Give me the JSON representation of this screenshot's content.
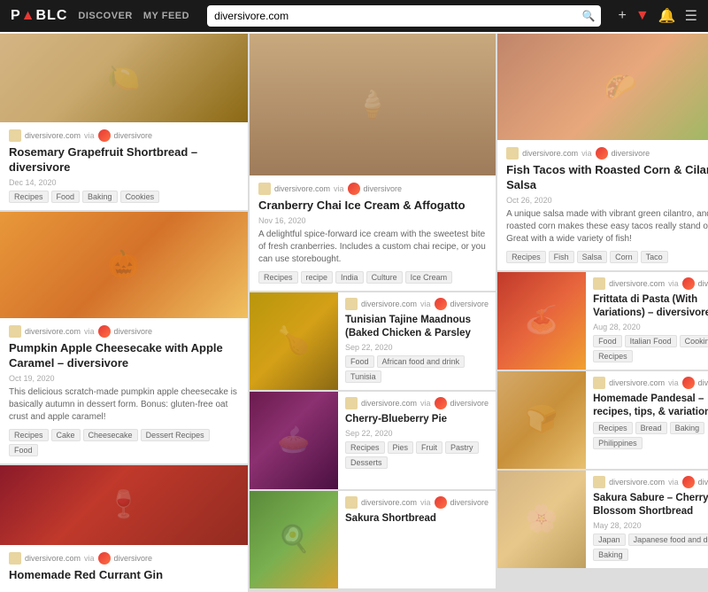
{
  "header": {
    "logo": "P▲BLC",
    "nav": [
      "DISCOVER",
      "MY FEED"
    ],
    "search_placeholder": "diversivore.com",
    "icons": {
      "+": "+",
      "heart": "♥",
      "bell": "🔔",
      "menu": "☰"
    }
  },
  "cards": {
    "rosemary": {
      "site": "diversivore.com",
      "via": "via",
      "user": "diversivore",
      "title": "Rosemary Grapefruit Shortbread – diversivore",
      "date": "Dec 14, 2020",
      "tags": [
        "Recipes",
        "Food",
        "Baking",
        "Cookies"
      ]
    },
    "pumpkin": {
      "site": "diversivore.com",
      "via": "via",
      "user": "diversivore",
      "title": "Pumpkin Apple Cheesecake with Apple Caramel – diversivore",
      "date": "Oct 19, 2020",
      "desc": "This delicious scratch-made pumpkin apple cheesecake is basically autumn in dessert form. Bonus: gluten-free oat crust and apple caramel!",
      "tags": [
        "Recipes",
        "Cake",
        "Cheesecake",
        "Dessert Recipes",
        "Food"
      ]
    },
    "redcurrant": {
      "site": "diversivore.com",
      "via": "via",
      "user": "diversivore",
      "title": "Homemade Red Currant Gin",
      "date": "",
      "tags": []
    },
    "cranberry": {
      "site": "diversivore.com",
      "via": "via",
      "user": "diversivore",
      "title": "Cranberry Chai Ice Cream & Affogatto",
      "date": "Nov 16, 2020",
      "desc": "A delightful spice-forward ice cream with the sweetest bite of fresh cranberries. Includes a custom chai recipe, or you can use storebought.",
      "tags": [
        "Recipes",
        "recipe",
        "India",
        "Culture",
        "Ice Cream"
      ]
    },
    "fishtacos": {
      "site": "diversivore.com",
      "via": "via",
      "user": "diversivore",
      "title": "Fish Tacos with Roasted Corn & Cilantro Salsa",
      "date": "Oct 26, 2020",
      "desc": "A unique salsa made with vibrant green cilantro, and roasted corn makes these easy tacos really stand out. Great with a wide variety of fish!",
      "tags": [
        "Recipes",
        "Fish",
        "Salsa",
        "Corn",
        "Taco"
      ]
    },
    "tunisian": {
      "site": "diversivore.com",
      "via": "via",
      "user": "diversivore",
      "title": "Tunisian Tajine Maadnous (Baked Chicken & Parsley",
      "date": "Sep 22, 2020",
      "tags": [
        "Food",
        "African food and drink",
        "Tunisia"
      ]
    },
    "frittata": {
      "site": "diversivore.com",
      "via": "via",
      "user": "diversivore",
      "title": "Frittata di Pasta (With Variations) – diversivore",
      "date": "Aug 28, 2020",
      "tags": [
        "Food",
        "Italian Food",
        "Cooking",
        "Recipes"
      ]
    },
    "cherry": {
      "site": "diversivore.com",
      "via": "via",
      "user": "diversivore",
      "title": "Cherry-Blueberry Pie",
      "date": "Sep 22, 2020",
      "tags": [
        "Recipes",
        "Pies",
        "Fruit",
        "Pastry",
        "Desserts"
      ]
    },
    "pandesal": {
      "site": "diversivore.com",
      "via": "via",
      "user": "diversivore",
      "title": "Homemade Pandesal – recipes, tips, & variations –",
      "date": "",
      "tags": [
        "Recipes",
        "Bread",
        "Baking",
        "Philippines"
      ]
    },
    "sakura_egg": {
      "site": "diversivore.com",
      "via": "via",
      "user": "diversivore",
      "title": "Sakura Sabure – Cherry Blossom Shortbread",
      "date": "May 28, 2020",
      "tags": [
        "Japan",
        "Japanese food and drink",
        "Baking"
      ]
    }
  }
}
